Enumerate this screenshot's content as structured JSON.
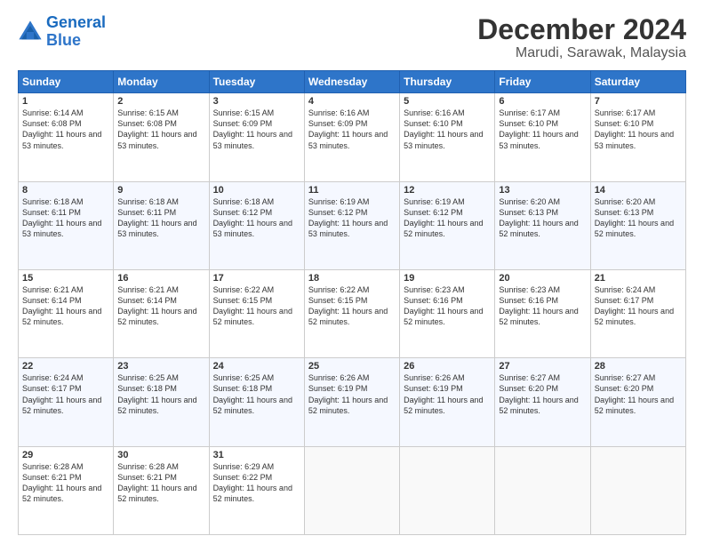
{
  "logo": {
    "line1": "General",
    "line2": "Blue"
  },
  "title": "December 2024",
  "subtitle": "Marudi, Sarawak, Malaysia",
  "days_header": [
    "Sunday",
    "Monday",
    "Tuesday",
    "Wednesday",
    "Thursday",
    "Friday",
    "Saturday"
  ],
  "weeks": [
    [
      {
        "day": "1",
        "rise": "Sunrise: 6:14 AM",
        "set": "Sunset: 6:08 PM",
        "daylight": "Daylight: 11 hours and 53 minutes."
      },
      {
        "day": "2",
        "rise": "Sunrise: 6:15 AM",
        "set": "Sunset: 6:08 PM",
        "daylight": "Daylight: 11 hours and 53 minutes."
      },
      {
        "day": "3",
        "rise": "Sunrise: 6:15 AM",
        "set": "Sunset: 6:09 PM",
        "daylight": "Daylight: 11 hours and 53 minutes."
      },
      {
        "day": "4",
        "rise": "Sunrise: 6:16 AM",
        "set": "Sunset: 6:09 PM",
        "daylight": "Daylight: 11 hours and 53 minutes."
      },
      {
        "day": "5",
        "rise": "Sunrise: 6:16 AM",
        "set": "Sunset: 6:10 PM",
        "daylight": "Daylight: 11 hours and 53 minutes."
      },
      {
        "day": "6",
        "rise": "Sunrise: 6:17 AM",
        "set": "Sunset: 6:10 PM",
        "daylight": "Daylight: 11 hours and 53 minutes."
      },
      {
        "day": "7",
        "rise": "Sunrise: 6:17 AM",
        "set": "Sunset: 6:10 PM",
        "daylight": "Daylight: 11 hours and 53 minutes."
      }
    ],
    [
      {
        "day": "8",
        "rise": "Sunrise: 6:18 AM",
        "set": "Sunset: 6:11 PM",
        "daylight": "Daylight: 11 hours and 53 minutes."
      },
      {
        "day": "9",
        "rise": "Sunrise: 6:18 AM",
        "set": "Sunset: 6:11 PM",
        "daylight": "Daylight: 11 hours and 53 minutes."
      },
      {
        "day": "10",
        "rise": "Sunrise: 6:18 AM",
        "set": "Sunset: 6:12 PM",
        "daylight": "Daylight: 11 hours and 53 minutes."
      },
      {
        "day": "11",
        "rise": "Sunrise: 6:19 AM",
        "set": "Sunset: 6:12 PM",
        "daylight": "Daylight: 11 hours and 53 minutes."
      },
      {
        "day": "12",
        "rise": "Sunrise: 6:19 AM",
        "set": "Sunset: 6:12 PM",
        "daylight": "Daylight: 11 hours and 52 minutes."
      },
      {
        "day": "13",
        "rise": "Sunrise: 6:20 AM",
        "set": "Sunset: 6:13 PM",
        "daylight": "Daylight: 11 hours and 52 minutes."
      },
      {
        "day": "14",
        "rise": "Sunrise: 6:20 AM",
        "set": "Sunset: 6:13 PM",
        "daylight": "Daylight: 11 hours and 52 minutes."
      }
    ],
    [
      {
        "day": "15",
        "rise": "Sunrise: 6:21 AM",
        "set": "Sunset: 6:14 PM",
        "daylight": "Daylight: 11 hours and 52 minutes."
      },
      {
        "day": "16",
        "rise": "Sunrise: 6:21 AM",
        "set": "Sunset: 6:14 PM",
        "daylight": "Daylight: 11 hours and 52 minutes."
      },
      {
        "day": "17",
        "rise": "Sunrise: 6:22 AM",
        "set": "Sunset: 6:15 PM",
        "daylight": "Daylight: 11 hours and 52 minutes."
      },
      {
        "day": "18",
        "rise": "Sunrise: 6:22 AM",
        "set": "Sunset: 6:15 PM",
        "daylight": "Daylight: 11 hours and 52 minutes."
      },
      {
        "day": "19",
        "rise": "Sunrise: 6:23 AM",
        "set": "Sunset: 6:16 PM",
        "daylight": "Daylight: 11 hours and 52 minutes."
      },
      {
        "day": "20",
        "rise": "Sunrise: 6:23 AM",
        "set": "Sunset: 6:16 PM",
        "daylight": "Daylight: 11 hours and 52 minutes."
      },
      {
        "day": "21",
        "rise": "Sunrise: 6:24 AM",
        "set": "Sunset: 6:17 PM",
        "daylight": "Daylight: 11 hours and 52 minutes."
      }
    ],
    [
      {
        "day": "22",
        "rise": "Sunrise: 6:24 AM",
        "set": "Sunset: 6:17 PM",
        "daylight": "Daylight: 11 hours and 52 minutes."
      },
      {
        "day": "23",
        "rise": "Sunrise: 6:25 AM",
        "set": "Sunset: 6:18 PM",
        "daylight": "Daylight: 11 hours and 52 minutes."
      },
      {
        "day": "24",
        "rise": "Sunrise: 6:25 AM",
        "set": "Sunset: 6:18 PM",
        "daylight": "Daylight: 11 hours and 52 minutes."
      },
      {
        "day": "25",
        "rise": "Sunrise: 6:26 AM",
        "set": "Sunset: 6:19 PM",
        "daylight": "Daylight: 11 hours and 52 minutes."
      },
      {
        "day": "26",
        "rise": "Sunrise: 6:26 AM",
        "set": "Sunset: 6:19 PM",
        "daylight": "Daylight: 11 hours and 52 minutes."
      },
      {
        "day": "27",
        "rise": "Sunrise: 6:27 AM",
        "set": "Sunset: 6:20 PM",
        "daylight": "Daylight: 11 hours and 52 minutes."
      },
      {
        "day": "28",
        "rise": "Sunrise: 6:27 AM",
        "set": "Sunset: 6:20 PM",
        "daylight": "Daylight: 11 hours and 52 minutes."
      }
    ],
    [
      {
        "day": "29",
        "rise": "Sunrise: 6:28 AM",
        "set": "Sunset: 6:21 PM",
        "daylight": "Daylight: 11 hours and 52 minutes."
      },
      {
        "day": "30",
        "rise": "Sunrise: 6:28 AM",
        "set": "Sunset: 6:21 PM",
        "daylight": "Daylight: 11 hours and 52 minutes."
      },
      {
        "day": "31",
        "rise": "Sunrise: 6:29 AM",
        "set": "Sunset: 6:22 PM",
        "daylight": "Daylight: 11 hours and 52 minutes."
      },
      null,
      null,
      null,
      null
    ]
  ]
}
